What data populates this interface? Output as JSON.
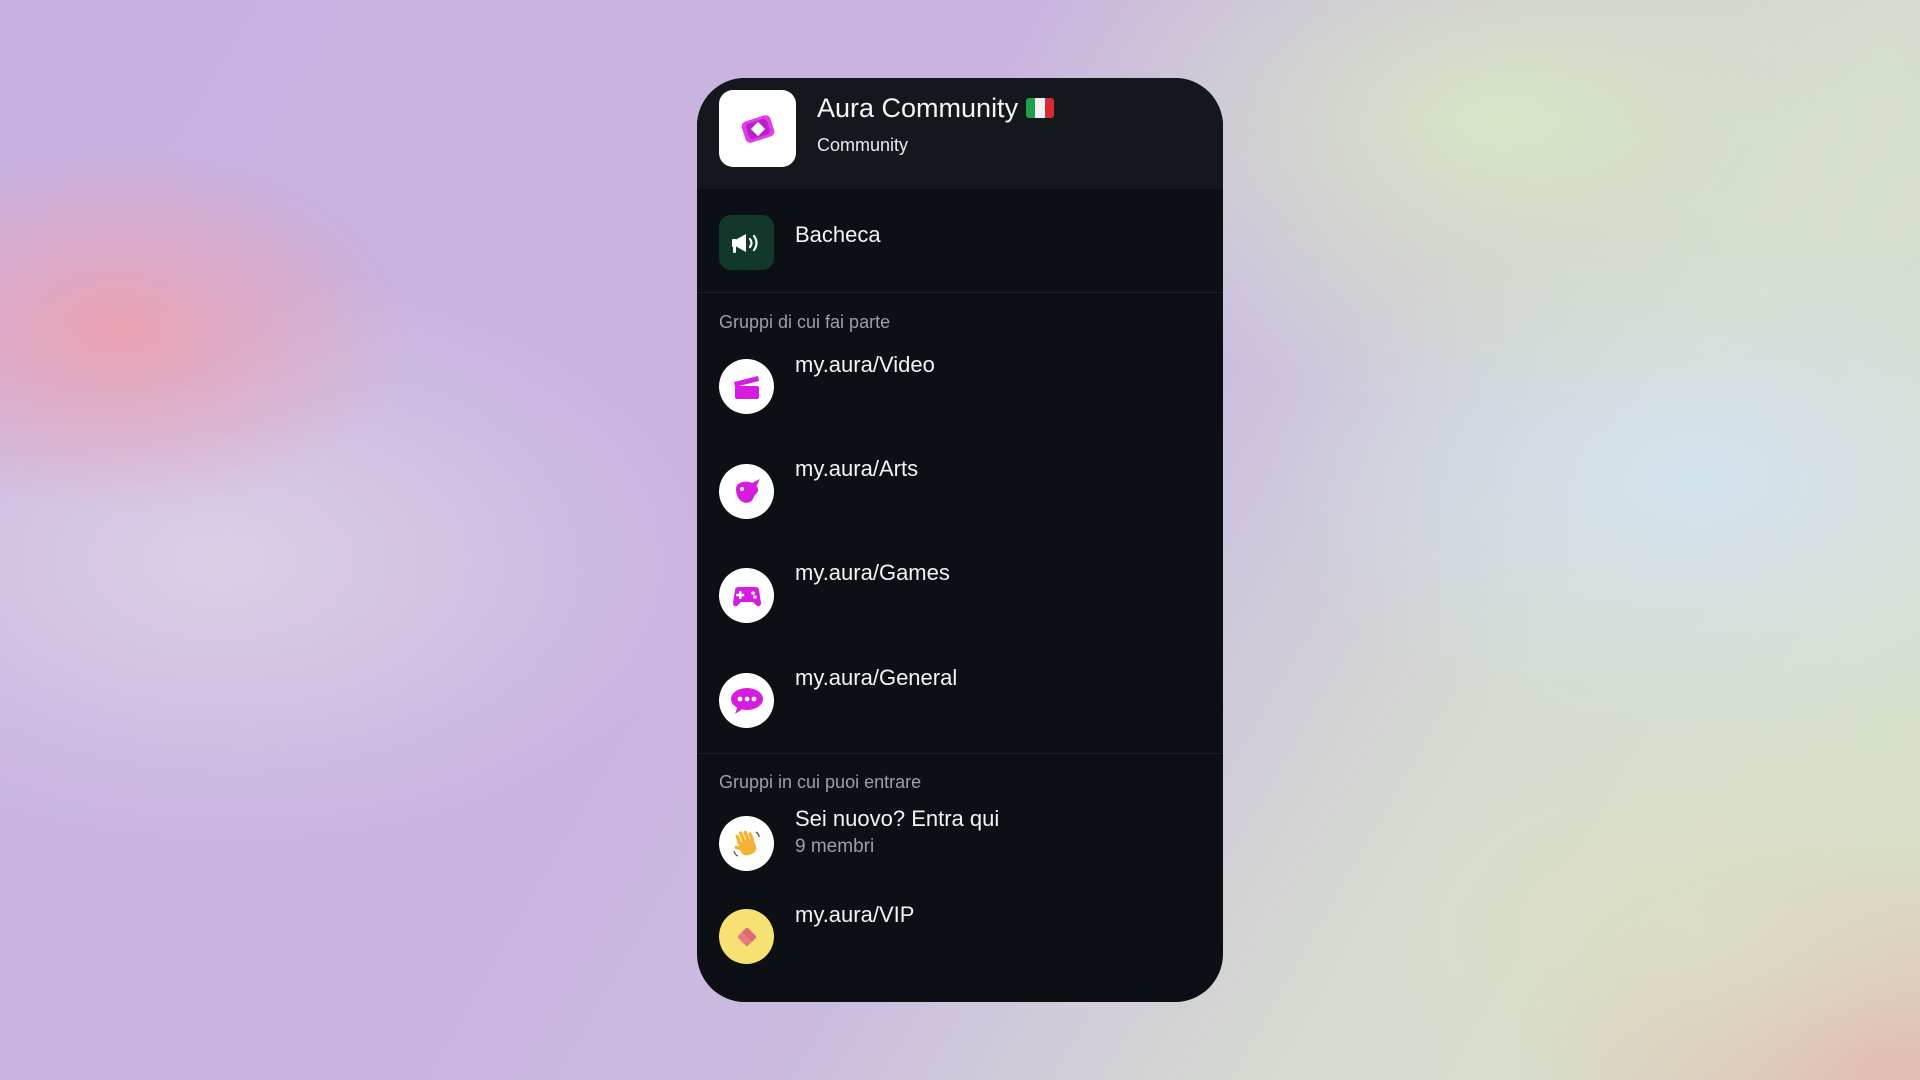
{
  "header": {
    "title": "Aura Community",
    "subtitle": "Community",
    "flag_icon": "italy-flag-icon"
  },
  "announcements": {
    "label": "Bacheca",
    "icon": "megaphone-icon",
    "icon_bg": "#12382c"
  },
  "joined_section": {
    "label": "Gruppi di cui fai parte",
    "groups": [
      {
        "name": "my.aura/Video",
        "icon": "clapperboard-icon"
      },
      {
        "name": "my.aura/Arts",
        "icon": "palette-icon"
      },
      {
        "name": "my.aura/Games",
        "icon": "gamepad-icon"
      },
      {
        "name": "my.aura/General",
        "icon": "speech-bubble-icon"
      }
    ]
  },
  "joinable_section": {
    "label": "Gruppi in cui puoi entrare",
    "groups": [
      {
        "name": "Sei nuovo? Entra qui",
        "members": "9 membri",
        "icon": "waving-hand-icon"
      },
      {
        "name": "my.aura/VIP",
        "icon": "diamond-icon"
      }
    ]
  },
  "colors": {
    "accent": "#d61ce0",
    "panel_bg": "#0c0f13",
    "header_bg": "#14171b",
    "muted_text": "#9aa0a6"
  }
}
